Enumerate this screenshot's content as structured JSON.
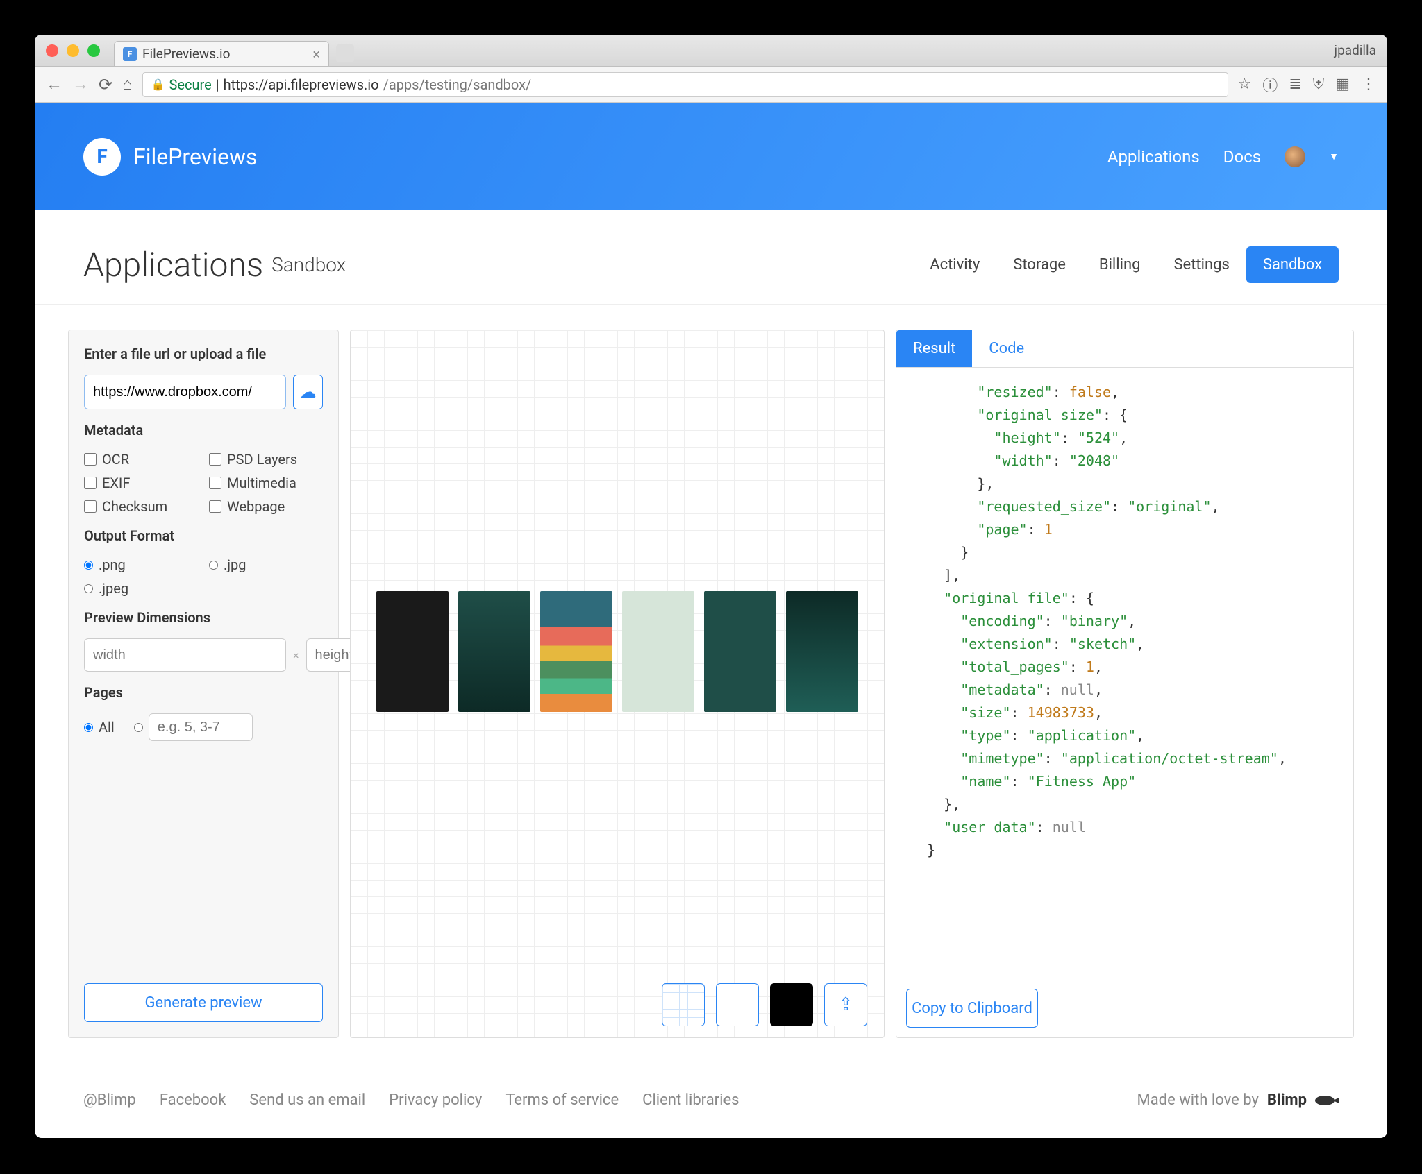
{
  "browser": {
    "tab_title": "FilePreviews.io",
    "profile": "jpadilla",
    "secure_label": "Secure",
    "url_host": "https://api.filepreviews.io",
    "url_path": "/apps/testing/sandbox/"
  },
  "hero": {
    "brand": "FilePreviews",
    "nav": {
      "applications": "Applications",
      "docs": "Docs"
    }
  },
  "page": {
    "title": "Applications",
    "subtitle": "Sandbox",
    "tabs": {
      "activity": "Activity",
      "storage": "Storage",
      "billing": "Billing",
      "settings": "Settings",
      "sandbox": "Sandbox"
    }
  },
  "left": {
    "enter_label": "Enter a file url or upload a file",
    "url_value": "https://www.dropbox.com/",
    "metadata_label": "Metadata",
    "metadata": {
      "ocr": "OCR",
      "psd": "PSD Layers",
      "exif": "EXIF",
      "multimedia": "Multimedia",
      "checksum": "Checksum",
      "webpage": "Webpage"
    },
    "format_label": "Output Format",
    "format": {
      "png": ".png",
      "jpg": ".jpg",
      "jpeg": ".jpeg"
    },
    "dim_label": "Preview Dimensions",
    "width_ph": "width",
    "height_ph": "height",
    "pages_label": "Pages",
    "pages_all": "All",
    "pages_ph": "e.g. 5, 3-7",
    "generate": "Generate preview"
  },
  "right": {
    "tab_result": "Result",
    "tab_code": "Code",
    "copy": "Copy to Clipboard"
  },
  "code": {
    "l1_k": "resized",
    "l1_v": "false",
    "l2_k": "original_size",
    "l3_k": "height",
    "l3_v": "524",
    "l4_k": "width",
    "l4_v": "2048",
    "l6_k": "requested_size",
    "l6_v": "original",
    "l7_k": "page",
    "l7_v": "1",
    "l10_k": "original_file",
    "l11_k": "encoding",
    "l11_v": "binary",
    "l12_k": "extension",
    "l12_v": "sketch",
    "l13_k": "total_pages",
    "l13_v": "1",
    "l14_k": "metadata",
    "l14_v": "null",
    "l15_k": "size",
    "l15_v": "14983733",
    "l16_k": "type",
    "l16_v": "application",
    "l17_k": "mimetype",
    "l17_v": "application/octet-stream",
    "l18_k": "name",
    "l18_v": "Fitness App",
    "l20_k": "user_data",
    "l20_v": "null"
  },
  "footer": {
    "blimp": "@Blimp",
    "facebook": "Facebook",
    "email": "Send us an email",
    "privacy": "Privacy policy",
    "terms": "Terms of service",
    "libs": "Client libraries",
    "made": "Made with love by",
    "blimp_brand": "Blimp"
  }
}
